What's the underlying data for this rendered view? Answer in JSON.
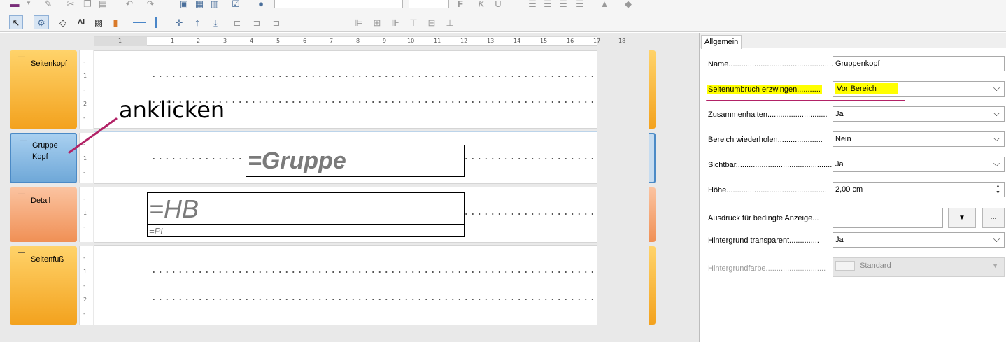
{
  "sections": [
    {
      "label_line1": "Seitenkopf",
      "label_line2": ""
    },
    {
      "label_line1": "Gruppe",
      "label_line2": "Kopf"
    },
    {
      "label_line1": "Detail",
      "label_line2": ""
    },
    {
      "label_line1": "Seitenfuß",
      "label_line2": ""
    }
  ],
  "fields": {
    "gruppe": "=Gruppe",
    "hb": "=HB",
    "pl": "=PL"
  },
  "annotation": "anklicken",
  "ruler": {
    "labels": [
      "1",
      "1",
      "2",
      "3",
      "4",
      "5",
      "6",
      "7",
      "8",
      "9",
      "10",
      "11",
      "12",
      "13",
      "14",
      "15",
      "16",
      "17",
      "18"
    ]
  },
  "vruler": {
    "labels": [
      "-",
      "1",
      "-",
      "2",
      "-"
    ]
  },
  "panel": {
    "tab": "Allgemein",
    "rows": [
      {
        "label": "Name.......................................................",
        "value": "Gruppenkopf"
      },
      {
        "label": "Seitenumbruch erzwingen...........",
        "value": "Vor Bereich"
      },
      {
        "label": "Zusammenhalten............................",
        "value": "Ja"
      },
      {
        "label": "Bereich wiederholen.....................",
        "value": "Nein"
      },
      {
        "label": "Sichtbar.....................................................",
        "value": "Ja"
      },
      {
        "label": "Höhe...............................................",
        "value": "2,00 cm"
      },
      {
        "label": "Ausdruck für bedingte Anzeige...",
        "value": ""
      },
      {
        "label": "Hintergrund transparent..............",
        "value": "Ja"
      },
      {
        "label": "Hintergrundfarbe............................",
        "value": "Standard"
      }
    ],
    "more_button": "...",
    "dropdown_arrow": "▼"
  },
  "colors": {
    "highlight": "#ffff00",
    "annotation_line": "#b22266",
    "section_orange": "#f3a21e",
    "section_blue": "#6fa8d8",
    "section_salmon": "#f09055"
  }
}
